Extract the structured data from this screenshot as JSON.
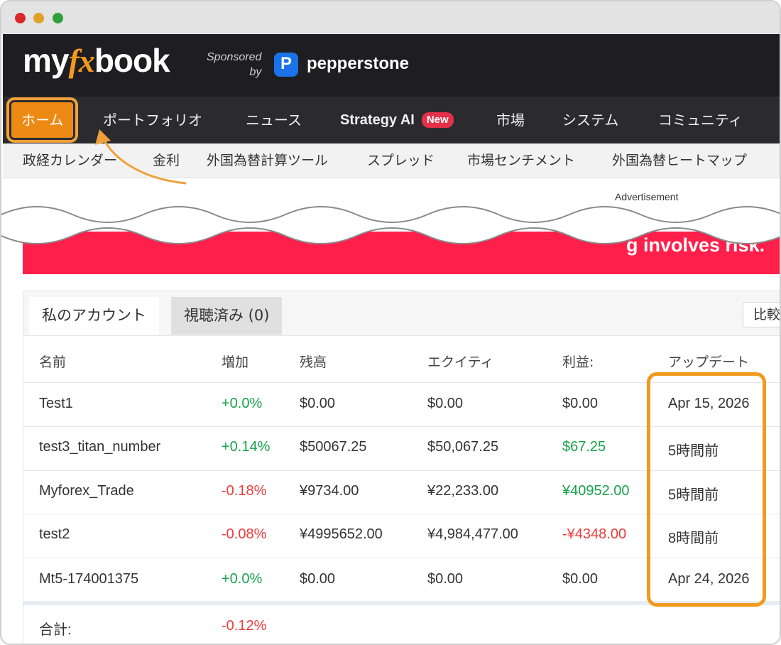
{
  "header": {
    "logo_my": "my",
    "logo_fx": "fx",
    "logo_book": "book",
    "sponsored_line1": "Sponsored",
    "sponsored_line2": "by",
    "sponsor_icon": "P",
    "sponsor_name": "pepperstone"
  },
  "mainnav": {
    "items": [
      "ホーム",
      "ポートフォリオ",
      "ニュース",
      "Strategy AI",
      "市場",
      "システム",
      "コミュニティ"
    ],
    "badge": "New"
  },
  "subnav": {
    "items": [
      "政経カレンダー",
      "金利",
      "外国為替計算ツール",
      "スプレッド",
      "市場センチメント",
      "外国為替ヒートマップ"
    ]
  },
  "ad": {
    "label": "Advertisement",
    "text": "g involves risk."
  },
  "accounts": {
    "tabs": [
      "私のアカウント",
      "視聴済み (0)"
    ],
    "compare_button": "比較",
    "columns": [
      "名前",
      "増加",
      "残高",
      "エクイティ",
      "利益:",
      "アップデート"
    ],
    "rows": [
      {
        "name": "Test1",
        "gain": "+0.0%",
        "balance": "$0.00",
        "equity": "$0.00",
        "profit": "$0.00",
        "updated": "Apr 15, 2026"
      },
      {
        "name": "test3_titan_number",
        "gain": "+0.14%",
        "balance": "$50067.25",
        "equity": "$50,067.25",
        "profit": "$67.25",
        "updated": "5時間前"
      },
      {
        "name": "Myforex_Trade",
        "gain": "-0.18%",
        "balance": "¥9734.00",
        "equity": "¥22,233.00",
        "profit": "¥40952.00",
        "updated": "5時間前"
      },
      {
        "name": "test2",
        "gain": "-0.08%",
        "balance": "¥4995652.00",
        "equity": "¥4,984,477.00",
        "profit": "-¥4348.00",
        "updated": "8時間前"
      },
      {
        "name": "Mt5-174001375",
        "gain": "+0.0%",
        "balance": "$0.00",
        "equity": "$0.00",
        "profit": "$0.00",
        "updated": "Apr 24, 2026"
      }
    ],
    "total_label": "合計:",
    "total_gain": "-0.12%"
  },
  "colors": {
    "accent": "#ec8a14",
    "highlight": "#f09a1c",
    "positive": "#16a34a",
    "negative": "#ef3b3b",
    "ad_banner": "#ff1f4b"
  }
}
